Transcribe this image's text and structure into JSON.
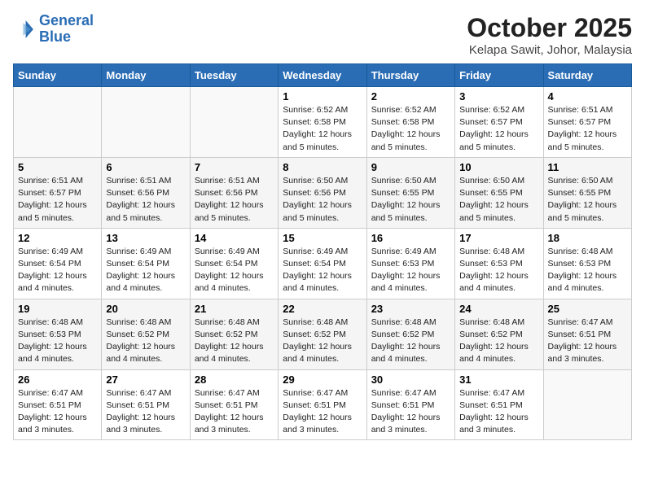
{
  "header": {
    "logo_line1": "General",
    "logo_line2": "Blue",
    "month_title": "October 2025",
    "location": "Kelapa Sawit, Johor, Malaysia"
  },
  "days_of_week": [
    "Sunday",
    "Monday",
    "Tuesday",
    "Wednesday",
    "Thursday",
    "Friday",
    "Saturday"
  ],
  "weeks": [
    [
      {
        "day": "",
        "info": ""
      },
      {
        "day": "",
        "info": ""
      },
      {
        "day": "",
        "info": ""
      },
      {
        "day": "1",
        "info": "Sunrise: 6:52 AM\nSunset: 6:58 PM\nDaylight: 12 hours and 5 minutes."
      },
      {
        "day": "2",
        "info": "Sunrise: 6:52 AM\nSunset: 6:58 PM\nDaylight: 12 hours and 5 minutes."
      },
      {
        "day": "3",
        "info": "Sunrise: 6:52 AM\nSunset: 6:57 PM\nDaylight: 12 hours and 5 minutes."
      },
      {
        "day": "4",
        "info": "Sunrise: 6:51 AM\nSunset: 6:57 PM\nDaylight: 12 hours and 5 minutes."
      }
    ],
    [
      {
        "day": "5",
        "info": "Sunrise: 6:51 AM\nSunset: 6:57 PM\nDaylight: 12 hours and 5 minutes."
      },
      {
        "day": "6",
        "info": "Sunrise: 6:51 AM\nSunset: 6:56 PM\nDaylight: 12 hours and 5 minutes."
      },
      {
        "day": "7",
        "info": "Sunrise: 6:51 AM\nSunset: 6:56 PM\nDaylight: 12 hours and 5 minutes."
      },
      {
        "day": "8",
        "info": "Sunrise: 6:50 AM\nSunset: 6:56 PM\nDaylight: 12 hours and 5 minutes."
      },
      {
        "day": "9",
        "info": "Sunrise: 6:50 AM\nSunset: 6:55 PM\nDaylight: 12 hours and 5 minutes."
      },
      {
        "day": "10",
        "info": "Sunrise: 6:50 AM\nSunset: 6:55 PM\nDaylight: 12 hours and 5 minutes."
      },
      {
        "day": "11",
        "info": "Sunrise: 6:50 AM\nSunset: 6:55 PM\nDaylight: 12 hours and 5 minutes."
      }
    ],
    [
      {
        "day": "12",
        "info": "Sunrise: 6:49 AM\nSunset: 6:54 PM\nDaylight: 12 hours and 4 minutes."
      },
      {
        "day": "13",
        "info": "Sunrise: 6:49 AM\nSunset: 6:54 PM\nDaylight: 12 hours and 4 minutes."
      },
      {
        "day": "14",
        "info": "Sunrise: 6:49 AM\nSunset: 6:54 PM\nDaylight: 12 hours and 4 minutes."
      },
      {
        "day": "15",
        "info": "Sunrise: 6:49 AM\nSunset: 6:54 PM\nDaylight: 12 hours and 4 minutes."
      },
      {
        "day": "16",
        "info": "Sunrise: 6:49 AM\nSunset: 6:53 PM\nDaylight: 12 hours and 4 minutes."
      },
      {
        "day": "17",
        "info": "Sunrise: 6:48 AM\nSunset: 6:53 PM\nDaylight: 12 hours and 4 minutes."
      },
      {
        "day": "18",
        "info": "Sunrise: 6:48 AM\nSunset: 6:53 PM\nDaylight: 12 hours and 4 minutes."
      }
    ],
    [
      {
        "day": "19",
        "info": "Sunrise: 6:48 AM\nSunset: 6:53 PM\nDaylight: 12 hours and 4 minutes."
      },
      {
        "day": "20",
        "info": "Sunrise: 6:48 AM\nSunset: 6:52 PM\nDaylight: 12 hours and 4 minutes."
      },
      {
        "day": "21",
        "info": "Sunrise: 6:48 AM\nSunset: 6:52 PM\nDaylight: 12 hours and 4 minutes."
      },
      {
        "day": "22",
        "info": "Sunrise: 6:48 AM\nSunset: 6:52 PM\nDaylight: 12 hours and 4 minutes."
      },
      {
        "day": "23",
        "info": "Sunrise: 6:48 AM\nSunset: 6:52 PM\nDaylight: 12 hours and 4 minutes."
      },
      {
        "day": "24",
        "info": "Sunrise: 6:48 AM\nSunset: 6:52 PM\nDaylight: 12 hours and 4 minutes."
      },
      {
        "day": "25",
        "info": "Sunrise: 6:47 AM\nSunset: 6:51 PM\nDaylight: 12 hours and 3 minutes."
      }
    ],
    [
      {
        "day": "26",
        "info": "Sunrise: 6:47 AM\nSunset: 6:51 PM\nDaylight: 12 hours and 3 minutes."
      },
      {
        "day": "27",
        "info": "Sunrise: 6:47 AM\nSunset: 6:51 PM\nDaylight: 12 hours and 3 minutes."
      },
      {
        "day": "28",
        "info": "Sunrise: 6:47 AM\nSunset: 6:51 PM\nDaylight: 12 hours and 3 minutes."
      },
      {
        "day": "29",
        "info": "Sunrise: 6:47 AM\nSunset: 6:51 PM\nDaylight: 12 hours and 3 minutes."
      },
      {
        "day": "30",
        "info": "Sunrise: 6:47 AM\nSunset: 6:51 PM\nDaylight: 12 hours and 3 minutes."
      },
      {
        "day": "31",
        "info": "Sunrise: 6:47 AM\nSunset: 6:51 PM\nDaylight: 12 hours and 3 minutes."
      },
      {
        "day": "",
        "info": ""
      }
    ]
  ]
}
